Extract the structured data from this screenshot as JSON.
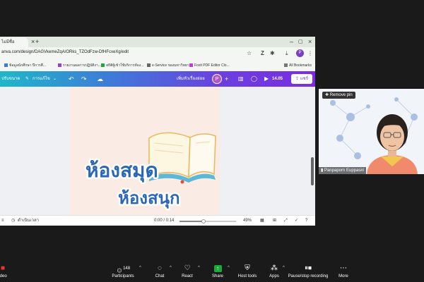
{
  "browser": {
    "tab_title": "ไม่มีชื่อ",
    "new_tab_symbol": "+",
    "url": "anva.com/design/DAGVkemeZqA/ORks_TZOdFzw-DfHFcxeXg/edit",
    "profile_letter": "P",
    "bookmarks": [
      "ข้อมูลนักศึกษา ปีการศึ...",
      "รายงานผลการปฏิบัติงา...",
      "สถิติผู้เข้าใช้บริการห้อง...",
      "e-Service ของมหาวิทยา...",
      "Foxit PDF Editor Clo..."
    ],
    "all_bookmarks": "All Bookmarks"
  },
  "canva": {
    "resize_label": "ปรับขนาด",
    "edit_label": "การแก้ไข",
    "design_title": "เพิ่มหัวเรื่องย่อย",
    "avatar_letter": "P",
    "play_time": "14.05",
    "share_label": "แชร์",
    "poster_line1": "ห้องสมุด",
    "poster_line2": "ห้องสนุก"
  },
  "footer": {
    "notes_label": "ดำเนินเวลา",
    "time": "0:00 / 0:14",
    "zoom": "49%",
    "progress": 0.42
  },
  "participant": {
    "remove_pin": "Remove pin",
    "name": "Panpaporn Euppasiri"
  },
  "zoom_toolbar": {
    "video_label": "ideo",
    "participants_count": "148",
    "items": [
      "Participants",
      "Chat",
      "React",
      "Share",
      "Host tools",
      "Apps",
      "Pause/stop recording",
      "More"
    ]
  },
  "colors": {
    "canva_gradient_start": "#1fb7c9",
    "canva_gradient_end": "#7a2de0",
    "poster_text_blue": "#2a67b8",
    "poster_bg": "#faebe5",
    "share_green": "#1fa83a"
  }
}
